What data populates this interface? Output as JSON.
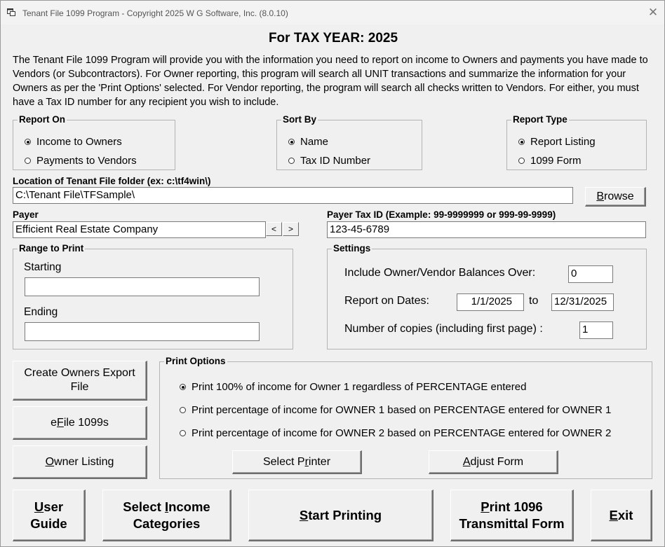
{
  "window": {
    "title": "Tenant File 1099 Program - Copyright 2025 W G Software, Inc. (8.0.10)",
    "close_symbol": "✕"
  },
  "heading": "For TAX YEAR:  2025",
  "intro": "The Tenant File 1099 Program will provide you with the information you need to report on income to Owners and payments you have made to Vendors (or Subcontractors).  For Owner reporting, this program will search all UNIT transactions and summarize the information for your Owners as per the 'Print Options' selected. For Vendor reporting, the program will search all checks written to Vendors.  For either, you must have a Tax ID number for any recipient you wish to include.",
  "report_on": {
    "title": "Report On",
    "options": [
      "Income to Owners",
      "Payments to Vendors"
    ],
    "selected": 0
  },
  "sort_by": {
    "title": "Sort By",
    "options": [
      "Name",
      "Tax ID Number"
    ],
    "selected": 0
  },
  "report_type": {
    "title": "Report Type",
    "options": [
      "Report Listing",
      "1099 Form"
    ],
    "selected": 0
  },
  "location": {
    "label": "Location of Tenant File folder (ex: c:\\tf4win\\)",
    "value": "C:\\Tenant File\\TFSample\\",
    "browse_label": "Browse",
    "browse_key": "B",
    "browse_rest": "rowse"
  },
  "payer": {
    "label": "Payer",
    "value": "Efficient Real Estate Company",
    "prev": "<",
    "next": ">"
  },
  "payer_tax_id": {
    "label": "Payer Tax ID  (Example: 99-9999999 or 999-99-9999)",
    "value": "123-45-6789"
  },
  "range": {
    "title": "Range to Print",
    "starting_label": "Starting",
    "starting_value": "",
    "ending_label": "Ending",
    "ending_value": ""
  },
  "settings": {
    "title": "Settings",
    "balances_label": "Include Owner/Vendor Balances Over:",
    "balances_value": "0",
    "dates_label": "Report on Dates:",
    "date_from": "1/1/2025",
    "to_label": "to",
    "date_to": "12/31/2025",
    "copies_label": "Number of copies (including first page) :",
    "copies_value": "1"
  },
  "left_buttons": {
    "export": "Create Owners Export File",
    "efile_key": "F",
    "efile_pre": "e",
    "efile_rest": "ile 1099s",
    "owner_key": "O",
    "owner_rest": "wner Listing"
  },
  "print_options": {
    "title": "Print Options",
    "options": [
      "Print 100% of income for Owner 1 regardless of PERCENTAGE entered",
      "Print percentage of income for OWNER 1 based on PERCENTAGE entered for OWNER 1",
      "Print percentage of income for OWNER 2 based on PERCENTAGE entered for OWNER 2"
    ],
    "selected": 0,
    "select_printer_pre": "Select P",
    "select_printer_key": "r",
    "select_printer_rest": "inter",
    "adjust_key": "A",
    "adjust_rest": "djust Form"
  },
  "bottom_buttons": {
    "user_key": "U",
    "user_rest": "ser",
    "user_line2": "Guide",
    "income_line1_pre": "Select ",
    "income_key": "I",
    "income_line1_rest": "ncome",
    "income_line2": "Categories",
    "start_key": "S",
    "start_rest": "tart Printing",
    "print1096_key": "P",
    "print1096_rest": "rint 1096",
    "print1096_line2": "Transmittal Form",
    "exit_key": "E",
    "exit_rest": "xit"
  }
}
